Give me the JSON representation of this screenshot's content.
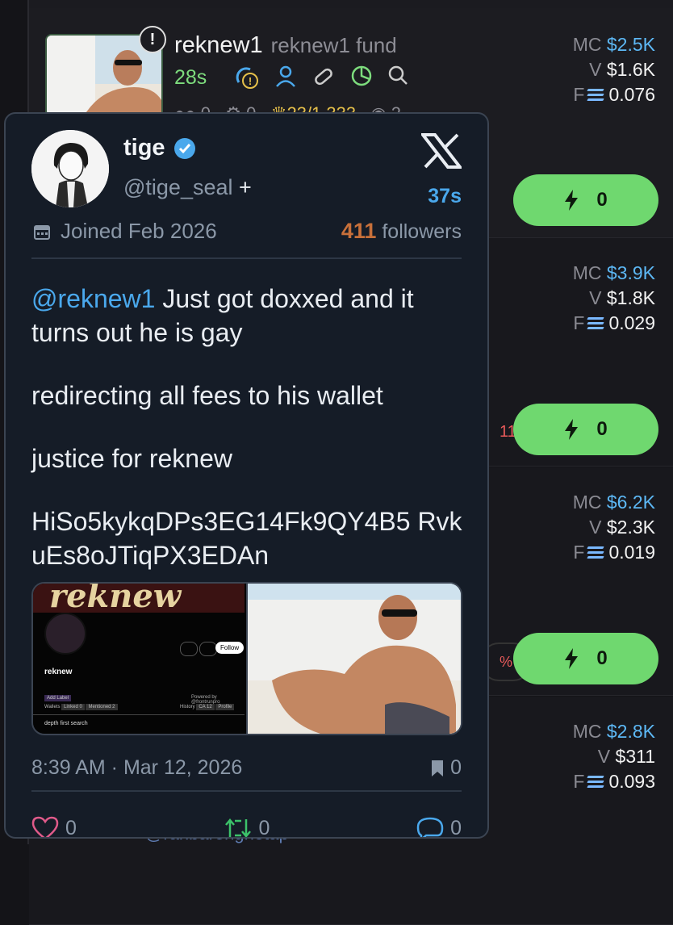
{
  "list": {
    "token": {
      "name": "reknew1",
      "fund_label": "reknew1 fund",
      "age": "28s",
      "stat_holders": "0",
      "stat_snipers": "0",
      "stat_top": "23/1,333",
      "stat_views": "2"
    },
    "rows": [
      {
        "mc_label": "MC",
        "mc": "$2.5K",
        "v_label": "V",
        "v": "$1.6K",
        "f_label": "F",
        "f": "0.076",
        "buy": "0"
      },
      {
        "mc_label": "MC",
        "mc": "$3.9K",
        "v_label": "V",
        "v": "$1.8K",
        "f_label": "F",
        "f": "0.029",
        "buy": "0",
        "side_text": "11"
      },
      {
        "mc_label": "MC",
        "mc": "$6.2K",
        "v_label": "V",
        "v": "$2.3K",
        "f_label": "F",
        "f": "0.019",
        "buy": "0",
        "side_text": "%"
      },
      {
        "mc_label": "MC",
        "mc": "$2.8K",
        "v_label": "V",
        "v": "$311",
        "f_label": "F",
        "f": "0.093"
      }
    ],
    "bottom_partial": "@ranbarenghetap"
  },
  "popup": {
    "display_name": "tige",
    "handle": "@tige_seal",
    "handle_plus": "+",
    "age": "37s",
    "joined": "Joined Feb 2026",
    "followers_count": "411",
    "followers_label": "followers",
    "tweet": {
      "mention": "@reknew1",
      "line1": " Just got doxxed and it turns out he is gay",
      "line2": "redirecting all fees to his wallet",
      "line3": "justice for reknew",
      "line4": "HiSo5kykqDPs3EG14Fk9QY4B5 RvkuEs8oJTiqPX3EDAn"
    },
    "media_left": {
      "banner": "reknew",
      "name": "reknew",
      "follow": "Follow",
      "add_label": "Add Label",
      "powered": "Powered by @frontrunpro",
      "wallets": "Wallets",
      "linked": "Linked 0",
      "mentioned": "Mentioned 2",
      "history": "History",
      "ca": "CA 12",
      "profile": "Profile",
      "bio": "depth first search"
    },
    "timestamp": "8:39 AM · Mar 12, 2026",
    "bookmarks": "0",
    "likes": "0",
    "retweets": "0",
    "replies": "0"
  },
  "colors": {
    "accent_blue": "#4aa8ec",
    "buy_green": "#6fd86f",
    "mc_blue": "#5db8f5",
    "followers_orange": "#c8703a"
  }
}
